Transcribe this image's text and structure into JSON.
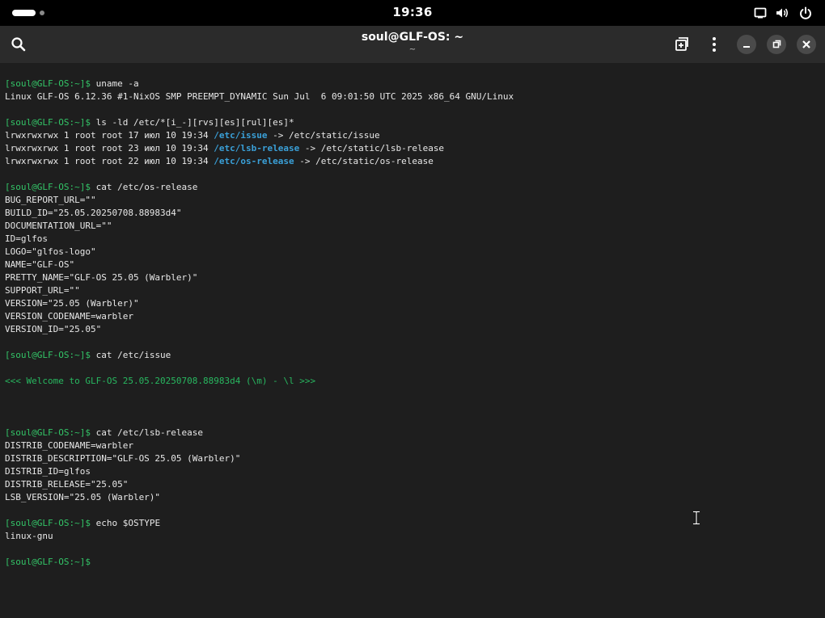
{
  "topbar": {
    "time": "19:36"
  },
  "window": {
    "title": "soul@GLF-OS: ~",
    "subtitle": "~"
  },
  "terminal": {
    "prompt": "[soul@GLF-OS:~]$",
    "lines": [
      {
        "prompt": "[soul@GLF-OS:~]$",
        "text": " uname -a"
      },
      {
        "text": "Linux GLF-OS 6.12.36 #1-NixOS SMP PREEMPT_DYNAMIC Sun Jul  6 09:01:50 UTC 2025 x86_64 GNU/Linux"
      },
      {
        "text": ""
      },
      {
        "prompt": "[soul@GLF-OS:~]$",
        "text": " ls -ld /etc/*[i_-][rvs][es][rul][es]*"
      },
      {
        "text": "lrwxrwxrwx 1 root root 17 июл 10 19:34 ",
        "link": "/etc/issue",
        "tail": " -> /etc/static/issue"
      },
      {
        "text": "lrwxrwxrwx 1 root root 23 июл 10 19:34 ",
        "link": "/etc/lsb-release",
        "tail": " -> /etc/static/lsb-release"
      },
      {
        "text": "lrwxrwxrwx 1 root root 22 июл 10 19:34 ",
        "link": "/etc/os-release",
        "tail": " -> /etc/static/os-release"
      },
      {
        "text": ""
      },
      {
        "prompt": "[soul@GLF-OS:~]$",
        "text": " cat /etc/os-release"
      },
      {
        "text": "BUG_REPORT_URL=\"\""
      },
      {
        "text": "BUILD_ID=\"25.05.20250708.88983d4\""
      },
      {
        "text": "DOCUMENTATION_URL=\"\""
      },
      {
        "text": "ID=glfos"
      },
      {
        "text": "LOGO=\"glfos-logo\""
      },
      {
        "text": "NAME=\"GLF-OS\""
      },
      {
        "text": "PRETTY_NAME=\"GLF-OS 25.05 (Warbler)\""
      },
      {
        "text": "SUPPORT_URL=\"\""
      },
      {
        "text": "VERSION=\"25.05 (Warbler)\""
      },
      {
        "text": "VERSION_CODENAME=warbler"
      },
      {
        "text": "VERSION_ID=\"25.05\""
      },
      {
        "text": ""
      },
      {
        "prompt": "[soul@GLF-OS:~]$",
        "text": " cat /etc/issue"
      },
      {
        "text": ""
      },
      {
        "welcome": "<<< Welcome to GLF-OS 25.05.20250708.88983d4 (\\m) - \\l >>>"
      },
      {
        "text": ""
      },
      {
        "text": ""
      },
      {
        "text": ""
      },
      {
        "prompt": "[soul@GLF-OS:~]$",
        "text": " cat /etc/lsb-release"
      },
      {
        "text": "DISTRIB_CODENAME=warbler"
      },
      {
        "text": "DISTRIB_DESCRIPTION=\"GLF-OS 25.05 (Warbler)\""
      },
      {
        "text": "DISTRIB_ID=glfos"
      },
      {
        "text": "DISTRIB_RELEASE=\"25.05\""
      },
      {
        "text": "LSB_VERSION=\"25.05 (Warbler)\""
      },
      {
        "text": ""
      },
      {
        "prompt": "[soul@GLF-OS:~]$",
        "text": " echo $OSTYPE"
      },
      {
        "text": "linux-gnu"
      },
      {
        "text": ""
      },
      {
        "prompt": "[soul@GLF-OS:~]$",
        "text": ""
      }
    ]
  },
  "icons": {
    "search": "search-icon",
    "new_tab": "new-tab-icon",
    "menu": "kebab-menu-icon",
    "minimize": "minimize-icon",
    "maximize": "maximize-icon",
    "close": "close-icon",
    "screen": "screen-icon",
    "volume": "volume-icon",
    "power": "power-icon"
  },
  "colors": {
    "background": "#1e1e1e",
    "titlebar": "#2b2b2b",
    "prompt": "#33c467",
    "link": "#3aa0d8",
    "text": "#e8e8e8"
  }
}
